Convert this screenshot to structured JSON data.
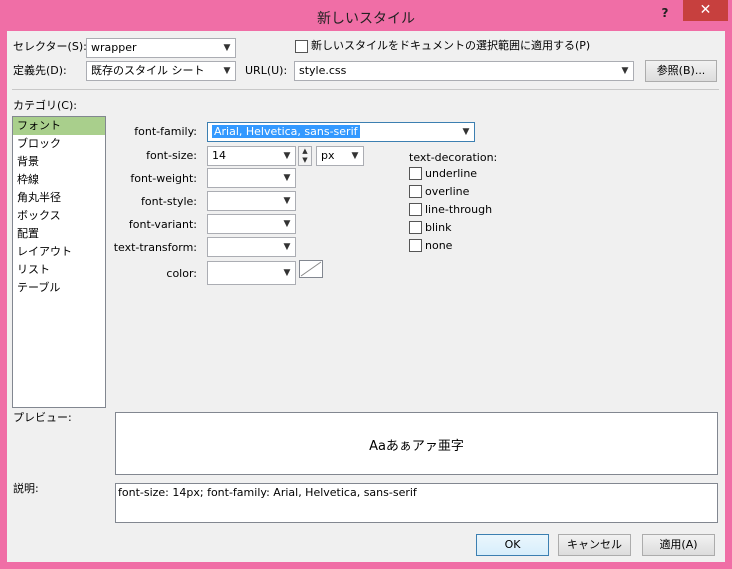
{
  "window": {
    "title": "新しいスタイル",
    "help": "?",
    "close": "✕"
  },
  "selector": {
    "label": "セレクター(S):",
    "value": "wrapper"
  },
  "new_style_checkbox": {
    "label": "新しいスタイルをドキュメントの選択範囲に適用する(P)",
    "checked": false
  },
  "define_in": {
    "label": "定義先(D):",
    "value": "既存のスタイル シート"
  },
  "url": {
    "label": "URL(U):",
    "value": "style.css"
  },
  "browse_button": {
    "label": "参照(B)..."
  },
  "category": {
    "label": "カテゴリ(C):",
    "items": [
      "フォント",
      "ブロック",
      "背景",
      "枠線",
      "角丸半径",
      "ボックス",
      "配置",
      "レイアウト",
      "リスト",
      "テーブル"
    ],
    "selected_index": 0
  },
  "font": {
    "family_label": "font-family:",
    "family_value": "Arial, Helvetica, sans-serif",
    "size_label": "font-size:",
    "size_value": "14",
    "size_unit": "px",
    "weight_label": "font-weight:",
    "style_label": "font-style:",
    "variant_label": "font-variant:",
    "transform_label": "text-transform:",
    "color_label": "color:"
  },
  "text_decoration": {
    "label": "text-decoration:",
    "options": [
      "underline",
      "overline",
      "line-through",
      "blink",
      "none"
    ]
  },
  "preview": {
    "label": "プレビュー:",
    "text": "Aaあぁアァ亜字"
  },
  "description": {
    "label": "説明:",
    "text": "font-size: 14px; font-family: Arial, Helvetica, sans-serif"
  },
  "buttons": {
    "ok": "OK",
    "cancel": "キャンセル",
    "apply": "適用(A)"
  }
}
